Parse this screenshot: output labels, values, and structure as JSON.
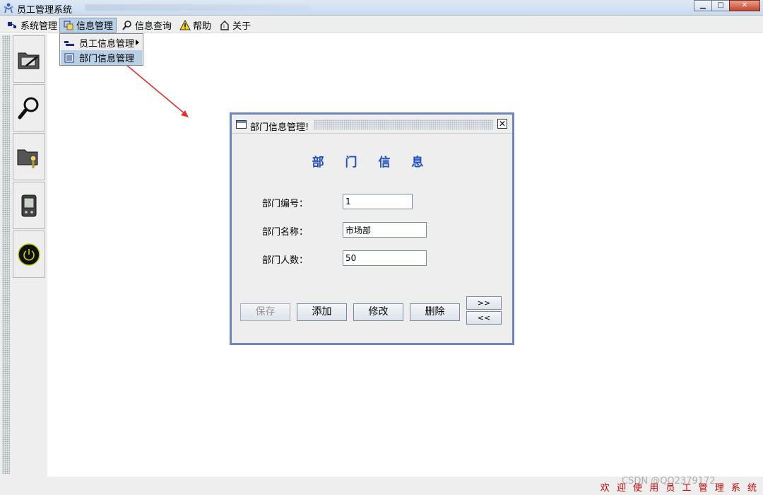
{
  "window": {
    "title": "员工管理系统",
    "buttons": {
      "minimize": "▁",
      "maximize": "□",
      "close": "✕"
    }
  },
  "menubar": {
    "items": [
      {
        "label": "系统管理",
        "icon": "system-icon"
      },
      {
        "label": "信息管理",
        "icon": "info-manage-icon"
      },
      {
        "label": "信息查询",
        "icon": "search-icon"
      },
      {
        "label": "帮助",
        "icon": "warning-icon"
      },
      {
        "label": "关于",
        "icon": "about-icon"
      }
    ]
  },
  "dropdown": {
    "items": [
      {
        "label": "员工信息管理",
        "has_submenu": true
      },
      {
        "label": "部门信息管理",
        "highlighted": true
      }
    ]
  },
  "toolbar": {
    "buttons": [
      "folder-edit-icon",
      "magnifier-icon",
      "folder-key-icon",
      "pda-icon",
      "power-icon"
    ]
  },
  "dialog": {
    "title": "部门信息管理!",
    "heading": "部 门 信 息",
    "fields": [
      {
        "label": "部门编号：",
        "value": "1"
      },
      {
        "label": "部门名称：",
        "value": "市场部"
      },
      {
        "label": "部门人数：",
        "value": "50"
      }
    ],
    "buttons": {
      "save": "保存",
      "add": "添加",
      "modify": "修改",
      "delete": "删除",
      "next": ">>",
      "prev": "<<"
    }
  },
  "statusbar": {
    "text": "欢 迎 使 用 员 工 管 理 系 统"
  },
  "watermark": "CSDN @QQ2379172",
  "colors": {
    "accent": "#1f4fc0",
    "frame_border": "#6d87bd",
    "status_text": "#cc0000",
    "arrow": "#e03030"
  }
}
